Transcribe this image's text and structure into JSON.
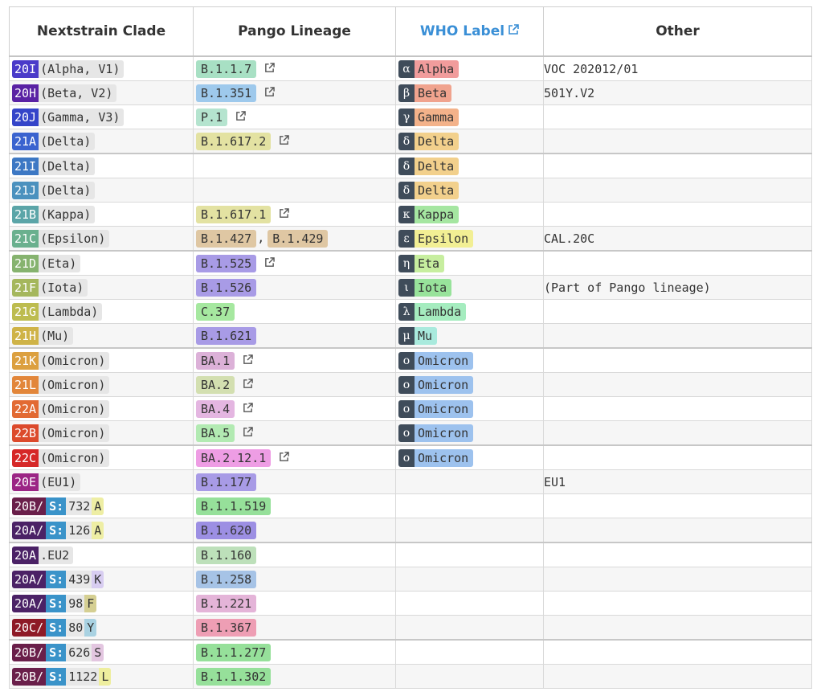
{
  "headers": {
    "clade": "Nextstrain Clade",
    "pango": "Pango Lineage",
    "who": "WHO Label",
    "other": "Other"
  },
  "icons": {
    "external_link": "external-link-icon"
  },
  "rows": [
    {
      "clade": "20I",
      "clade_text": "(Alpha, V1)",
      "clade_color": "#4a3bc9",
      "pango": [
        {
          "name": "B.1.1.7",
          "color": "#a8e0c4"
        }
      ],
      "pango_link": true,
      "who_glyph": "α",
      "who": "Alpha",
      "who_color": "#f19c9c",
      "other": "VOC 202012/01"
    },
    {
      "clade": "20H",
      "clade_text": "(Beta, V2)",
      "clade_color": "#5a22a4",
      "pango": [
        {
          "name": "B.1.351",
          "color": "#9ec9ec"
        }
      ],
      "pango_link": true,
      "who_glyph": "β",
      "who": "Beta",
      "who_color": "#f0a38e",
      "other": "501Y.V2"
    },
    {
      "clade": "20J",
      "clade_text": "(Gamma, V3)",
      "clade_color": "#3545c9",
      "pango": [
        {
          "name": "P.1",
          "color": "#b5e4cf"
        }
      ],
      "pango_link": true,
      "who_glyph": "γ",
      "who": "Gamma",
      "who_color": "#f3b28a",
      "other": ""
    },
    {
      "clade": "21A",
      "clade_text": "(Delta)",
      "clade_color": "#3a63cf",
      "pango": [
        {
          "name": "B.1.617.2",
          "color": "#e3e2a2"
        }
      ],
      "pango_link": true,
      "who_glyph": "δ",
      "who": "Delta",
      "who_color": "#f2d08c",
      "other": ""
    },
    {
      "clade": "21I",
      "clade_text": "(Delta)",
      "clade_color": "#3d78c4",
      "pango": [],
      "pango_link": false,
      "who_glyph": "δ",
      "who": "Delta",
      "who_color": "#f2d08c",
      "other": ""
    },
    {
      "clade": "21J",
      "clade_text": "(Delta)",
      "clade_color": "#4b91be",
      "pango": [],
      "pango_link": false,
      "who_glyph": "δ",
      "who": "Delta",
      "who_color": "#f2d08c",
      "other": ""
    },
    {
      "clade": "21B",
      "clade_text": "(Kappa)",
      "clade_color": "#5ba5a8",
      "pango": [
        {
          "name": "B.1.617.1",
          "color": "#e3e2a2"
        }
      ],
      "pango_link": true,
      "who_glyph": "κ",
      "who": "Kappa",
      "who_color": "#a5e6a1",
      "other": ""
    },
    {
      "clade": "21C",
      "clade_text": "(Epsilon)",
      "clade_color": "#6ab08e",
      "pango": [
        {
          "name": "B.1.427",
          "color": "#dfc7a3"
        },
        {
          "name": "B.1.429",
          "color": "#dfc7a3"
        }
      ],
      "pango_link": false,
      "who_glyph": "ε",
      "who": "Epsilon",
      "who_color": "#f2ef94",
      "other": "CAL.20C"
    },
    {
      "clade": "21D",
      "clade_text": "(Eta)",
      "clade_color": "#86b36f",
      "pango": [
        {
          "name": "B.1.525",
          "color": "#a89be6"
        }
      ],
      "pango_link": true,
      "who_glyph": "η",
      "who": "Eta",
      "who_color": "#c7ee9f",
      "other": ""
    },
    {
      "clade": "21F",
      "clade_text": "(Iota)",
      "clade_color": "#a5b75c",
      "pango": [
        {
          "name": "B.1.526",
          "color": "#a89be6"
        }
      ],
      "pango_link": false,
      "who_glyph": "ι",
      "who": "Iota",
      "who_color": "#98e39b",
      "other": "(Part of Pango lineage)"
    },
    {
      "clade": "21G",
      "clade_text": "(Lambda)",
      "clade_color": "#bdbc4f",
      "pango": [
        {
          "name": "C.37",
          "color": "#a6e8a0"
        }
      ],
      "pango_link": false,
      "who_glyph": "λ",
      "who": "Lambda",
      "who_color": "#a5ecbf",
      "other": ""
    },
    {
      "clade": "21H",
      "clade_text": "(Mu)",
      "clade_color": "#cfb347",
      "pango": [
        {
          "name": "B.1.621",
          "color": "#a89be6"
        }
      ],
      "pango_link": false,
      "who_glyph": "μ",
      "who": "Mu",
      "who_color": "#a9eadd",
      "other": ""
    },
    {
      "clade": "21K",
      "clade_text": "(Omicron)",
      "clade_color": "#dca03f",
      "pango": [
        {
          "name": "BA.1",
          "color": "#dcb1d8"
        }
      ],
      "pango_link": true,
      "who_glyph": "ο",
      "who": "Omicron",
      "who_color": "#9dc2ee",
      "other": ""
    },
    {
      "clade": "21L",
      "clade_text": "(Omicron)",
      "clade_color": "#e2863a",
      "pango": [
        {
          "name": "BA.2",
          "color": "#d3dfb0"
        }
      ],
      "pango_link": true,
      "who_glyph": "ο",
      "who": "Omicron",
      "who_color": "#9dc2ee",
      "other": ""
    },
    {
      "clade": "22A",
      "clade_text": "(Omicron)",
      "clade_color": "#e26a33",
      "pango": [
        {
          "name": "BA.4",
          "color": "#e4b6e1"
        }
      ],
      "pango_link": true,
      "who_glyph": "ο",
      "who": "Omicron",
      "who_color": "#9dc2ee",
      "other": ""
    },
    {
      "clade": "22B",
      "clade_text": "(Omicron)",
      "clade_color": "#dc4a2c",
      "pango": [
        {
          "name": "BA.5",
          "color": "#b2eab2"
        }
      ],
      "pango_link": true,
      "who_glyph": "ο",
      "who": "Omicron",
      "who_color": "#9dc2ee",
      "other": ""
    },
    {
      "clade": "22C",
      "clade_text": "(Omicron)",
      "clade_color": "#d62828",
      "pango": [
        {
          "name": "BA.2.12.1",
          "color": "#ee9de4"
        }
      ],
      "pango_link": true,
      "who_glyph": "ο",
      "who": "Omicron",
      "who_color": "#9dc2ee",
      "other": ""
    },
    {
      "clade": "20E",
      "clade_text": " (EU1)",
      "clade_color": "#9b2585",
      "pango": [
        {
          "name": "B.1.177",
          "color": "#a89be6"
        }
      ],
      "pango_link": false,
      "who_glyph": "",
      "who": "",
      "who_color": "",
      "other": "EU1"
    },
    {
      "clade": "20B/",
      "s": "S:",
      "s_num": "732",
      "s_letter": "A",
      "clade_color": "#6a1f4a",
      "s_letter_color": "#eeeea4",
      "pango": [
        {
          "name": "B.1.1.519",
          "color": "#96e09a"
        }
      ],
      "pango_link": false,
      "who_glyph": "",
      "who": "",
      "who_color": "",
      "other": ""
    },
    {
      "clade": "20A/",
      "s": "S:",
      "s_num": "126",
      "s_letter": "A",
      "clade_color": "#4b2266",
      "s_letter_color": "#eeeea4",
      "pango": [
        {
          "name": "B.1.620",
          "color": "#9c8fe3"
        }
      ],
      "pango_link": false,
      "who_glyph": "",
      "who": "",
      "who_color": "",
      "other": ""
    },
    {
      "clade": "20A",
      "clade_text": ".EU2",
      "clade_color": "#4b2266",
      "pango": [
        {
          "name": "B.1.160",
          "color": "#bde0ba"
        }
      ],
      "pango_link": false,
      "who_glyph": "",
      "who": "",
      "who_color": "",
      "other": ""
    },
    {
      "clade": "20A/",
      "s": "S:",
      "s_num": "439",
      "s_letter": "K",
      "clade_color": "#4b2266",
      "s_letter_color": "#d8cdf1",
      "pango": [
        {
          "name": "B.1.258",
          "color": "#a6c3e6"
        }
      ],
      "pango_link": false,
      "who_glyph": "",
      "who": "",
      "who_color": "",
      "other": ""
    },
    {
      "clade": "20A/",
      "s": "S:",
      "s_num": "98",
      "s_letter": "F",
      "clade_color": "#4b2266",
      "s_letter_color": "#d5cf92",
      "pango": [
        {
          "name": "B.1.221",
          "color": "#e4b4d8"
        }
      ],
      "pango_link": false,
      "who_glyph": "",
      "who": "",
      "who_color": "",
      "other": ""
    },
    {
      "clade": "20C/",
      "s": "S:",
      "s_num": "80",
      "s_letter": "Y",
      "clade_color": "#8e1a27",
      "s_letter_color": "#a9d2e2",
      "pango": [
        {
          "name": "B.1.367",
          "color": "#ee9eb4"
        }
      ],
      "pango_link": false,
      "who_glyph": "",
      "who": "",
      "who_color": "",
      "other": ""
    },
    {
      "clade": "20B/",
      "s": "S:",
      "s_num": "626",
      "s_letter": "S",
      "clade_color": "#6a1f4a",
      "s_letter_color": "#e3c6e0",
      "pango": [
        {
          "name": "B.1.1.277",
          "color": "#96e09a"
        }
      ],
      "pango_link": false,
      "who_glyph": "",
      "who": "",
      "who_color": "",
      "other": ""
    },
    {
      "clade": "20B/",
      "s": "S:",
      "s_num": "1122",
      "s_letter": "L",
      "clade_color": "#6a1f4a",
      "s_letter_color": "#eeee9e",
      "pango": [
        {
          "name": "B.1.1.302",
          "color": "#96e09a"
        }
      ],
      "pango_link": false,
      "who_glyph": "",
      "who": "",
      "who_color": "",
      "other": ""
    }
  ],
  "s_color": "#3a93c9"
}
